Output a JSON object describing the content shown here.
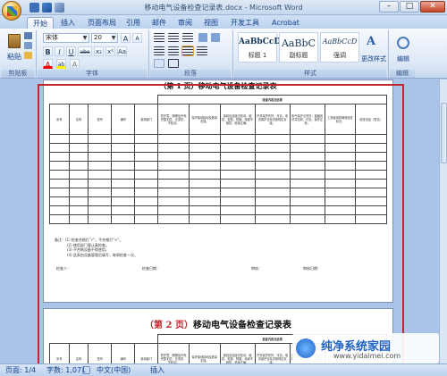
{
  "window": {
    "title": "移动电气设备检查记录表.docx - Microsoft Word"
  },
  "qat": {
    "save": "save-icon",
    "undo": "undo-icon",
    "redo": "redo-icon"
  },
  "window_buttons": {
    "minimize": "–",
    "maximize": "□",
    "close": "✕"
  },
  "tabs": [
    "开始",
    "插入",
    "页面布局",
    "引用",
    "邮件",
    "审阅",
    "视图",
    "开发工具",
    "Acrobat"
  ],
  "ribbon": {
    "clipboard": {
      "label": "剪贴板",
      "paste": "粘贴"
    },
    "font": {
      "label": "字体",
      "family": "宋体",
      "size": "20",
      "bold": "B",
      "italic": "I",
      "underline": "U",
      "strike": "abe",
      "subscript": "x₂",
      "superscript": "x²",
      "change_case": "Aa",
      "font_color": "A",
      "grow": "A",
      "shrink": "A",
      "clear": "A",
      "highlight": "ab"
    },
    "paragraph": {
      "label": "段落"
    },
    "styles": {
      "label": "样式",
      "items": [
        {
          "sample": "AaBbCcD",
          "name": "标题 1"
        },
        {
          "sample": "AaBbC",
          "name": "副标题"
        },
        {
          "sample": "AaBbCcD",
          "name": "强调"
        }
      ],
      "change": "更改样式"
    },
    "editing": {
      "label": "编辑",
      "edit": "编辑"
    }
  },
  "document": {
    "page1_title": "（第 1 页）移动电气设备检查记录表",
    "page2_title_prefix": "（第 2 页）",
    "page2_title_text": "移动电气设备检查记录表",
    "group_header": "检查内容及结果",
    "columns": [
      "序号",
      "名称",
      "型号",
      "编号",
      "使用部门",
      "防护罩、隔爆及外壳完整无损、无变形、不松动。",
      "保护接地接地及数量无误。",
      "接线及连接无松动、破损、松散、短路。电缆不破损，绝缘正确。",
      "开关保护完好、可靠；电流保护当电流按规定安装。",
      "电气保护当完好，接触良好并控制、可靠。操作正常。",
      "工具使用放牌或检查标记。",
      "检查总结（签名）"
    ],
    "notes": [
      "备注：(1) 检查合格打\"√\"，不合格打\"×\"。",
      "(2) 使用部门要认真检查。",
      "(3) 不合格设备不得使用。",
      "(4) 此表由设备管理员填写，每周检查一次。"
    ],
    "signatures": [
      "检查人：",
      "检查日期：",
      "审核：",
      "审核日期："
    ]
  },
  "status": {
    "page": "页面: 1/4",
    "words": "字数: 1,071",
    "language": "中文(中国)",
    "mode": "插入"
  },
  "watermark": {
    "brand": "纯净系统家园",
    "url": "www.yidaimei.com"
  }
}
